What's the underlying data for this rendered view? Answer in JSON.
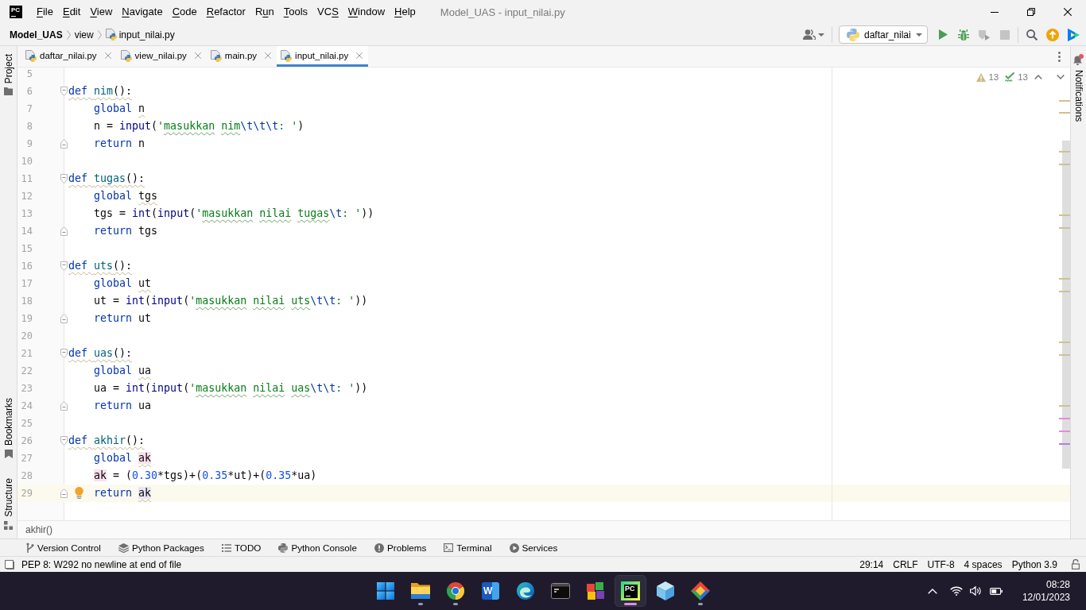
{
  "title_bar": {
    "logo": "PC",
    "menu": [
      {
        "key": "F",
        "rest": "ile"
      },
      {
        "key": "E",
        "rest": "dit"
      },
      {
        "key": "V",
        "rest": "iew"
      },
      {
        "key": "N",
        "rest": "avigate"
      },
      {
        "key": "C",
        "rest": "ode"
      },
      {
        "key": "R",
        "rest": "efactor"
      },
      {
        "lead": "R",
        "key": "u",
        "rest": "n"
      },
      {
        "key": "T",
        "rest": "ools"
      },
      {
        "lead": "VC",
        "key": "S"
      },
      {
        "key": "W",
        "rest": "indow"
      },
      {
        "key": "H",
        "rest": "elp"
      }
    ],
    "title": "Model_UAS - input_nilai.py"
  },
  "navigation_bar": {
    "breadcrumbs": [
      {
        "label": "Model_UAS",
        "kind": "project"
      },
      {
        "label": "view",
        "kind": "folder"
      },
      {
        "label": "input_nilai.py",
        "kind": "file"
      }
    ],
    "run_configuration": "daftar_nilai",
    "actions": [
      {
        "kind": "run",
        "disabled": false
      },
      {
        "kind": "debug",
        "disabled": false
      },
      {
        "kind": "coverage",
        "disabled": true
      },
      {
        "kind": "stop",
        "disabled": true
      }
    ]
  },
  "left_strip": [
    {
      "label": "Project",
      "kind": "project",
      "selected": false
    },
    {
      "label": "Bookmarks",
      "kind": "bookmarks",
      "selected": false
    },
    {
      "label": "Structure",
      "kind": "structure",
      "selected": false
    }
  ],
  "right_strip": {
    "label": "Notifications",
    "unread": true,
    "selected": false
  },
  "tabs": [
    {
      "label": "daftar_nilai.py",
      "selected": false
    },
    {
      "label": "view_nilai.py",
      "selected": false
    },
    {
      "label": "main.py",
      "selected": false
    },
    {
      "label": "input_nilai.py",
      "selected": true
    }
  ],
  "editor": {
    "inspections": [
      {
        "kind": "warning",
        "count": "13"
      },
      {
        "kind": "typo",
        "count": "13"
      }
    ],
    "lines": [
      {
        "number": "5",
        "current": false,
        "bulb": false
      },
      {
        "number": "6",
        "current": false,
        "bulb": false,
        "expanded": true,
        "tokens": [
          {
            "text": "def ",
            "kind": "keyword",
            "warning": true
          },
          {
            "text": "nim",
            "kind": "function",
            "warning": true
          },
          {
            "text": "():",
            "kind": "plain",
            "warning": true
          }
        ],
        "children": [
          {
            "number": "7",
            "current": false,
            "bulb": false,
            "tokens": [
              {
                "text": "global ",
                "kind": "keyword"
              },
              {
                "text": "n",
                "kind": "plain",
                "warning": true
              }
            ]
          },
          {
            "number": "8",
            "current": false,
            "bulb": false,
            "tokens": [
              {
                "text": "n = ",
                "kind": "plain"
              },
              {
                "text": "input",
                "kind": "builtin"
              },
              {
                "text": "(",
                "kind": "plain"
              },
              {
                "text": "'",
                "kind": "string"
              },
              {
                "text": "masukkan nim",
                "kind": "string",
                "typo": true
              },
              {
                "text": "\\t\\t\\t",
                "kind": "escape"
              },
              {
                "text": ": '",
                "kind": "string"
              },
              {
                "text": ")",
                "kind": "plain"
              }
            ]
          },
          {
            "number": "9",
            "current": false,
            "bulb": false,
            "tokens": [
              {
                "text": "return ",
                "kind": "keyword"
              },
              {
                "text": "n",
                "kind": "plain"
              }
            ]
          }
        ]
      },
      {
        "number": "10",
        "current": false,
        "bulb": false
      },
      {
        "number": "11",
        "current": false,
        "bulb": false,
        "expanded": true,
        "tokens": [
          {
            "text": "def ",
            "kind": "keyword",
            "warning": true
          },
          {
            "text": "tugas",
            "kind": "function",
            "warning": true
          },
          {
            "text": "():",
            "kind": "plain",
            "warning": true
          }
        ],
        "children": [
          {
            "number": "12",
            "current": false,
            "bulb": false,
            "tokens": [
              {
                "text": "global ",
                "kind": "keyword"
              },
              {
                "text": "tgs",
                "kind": "plain",
                "warning": true
              }
            ]
          },
          {
            "number": "13",
            "current": false,
            "bulb": false,
            "tokens": [
              {
                "text": "tgs = ",
                "kind": "plain"
              },
              {
                "text": "int",
                "kind": "builtin"
              },
              {
                "text": "(",
                "kind": "plain"
              },
              {
                "text": "input",
                "kind": "builtin"
              },
              {
                "text": "(",
                "kind": "plain"
              },
              {
                "text": "'",
                "kind": "string"
              },
              {
                "text": "masukkan nilai tugas",
                "kind": "string",
                "typo": true
              },
              {
                "text": "\\t",
                "kind": "escape"
              },
              {
                "text": ": '",
                "kind": "string"
              },
              {
                "text": "))",
                "kind": "plain"
              }
            ]
          },
          {
            "number": "14",
            "current": false,
            "bulb": false,
            "tokens": [
              {
                "text": "return ",
                "kind": "keyword"
              },
              {
                "text": "tgs",
                "kind": "plain"
              }
            ]
          }
        ]
      },
      {
        "number": "15",
        "current": false,
        "bulb": false
      },
      {
        "number": "16",
        "current": false,
        "bulb": false,
        "expanded": true,
        "tokens": [
          {
            "text": "def ",
            "kind": "keyword",
            "warning": true
          },
          {
            "text": "uts",
            "kind": "function",
            "warning": true
          },
          {
            "text": "():",
            "kind": "plain",
            "warning": true
          }
        ],
        "children": [
          {
            "number": "17",
            "current": false,
            "bulb": false,
            "tokens": [
              {
                "text": "global ",
                "kind": "keyword"
              },
              {
                "text": "ut",
                "kind": "plain",
                "warning": true
              }
            ]
          },
          {
            "number": "18",
            "current": false,
            "bulb": false,
            "tokens": [
              {
                "text": "ut = ",
                "kind": "plain"
              },
              {
                "text": "int",
                "kind": "builtin"
              },
              {
                "text": "(",
                "kind": "plain"
              },
              {
                "text": "input",
                "kind": "builtin"
              },
              {
                "text": "(",
                "kind": "plain"
              },
              {
                "text": "'",
                "kind": "string"
              },
              {
                "text": "masukkan nilai uts",
                "kind": "string",
                "typo": true
              },
              {
                "text": "\\t\\t",
                "kind": "escape"
              },
              {
                "text": ": '",
                "kind": "string"
              },
              {
                "text": "))",
                "kind": "plain"
              }
            ]
          },
          {
            "number": "19",
            "current": false,
            "bulb": false,
            "tokens": [
              {
                "text": "return ",
                "kind": "keyword"
              },
              {
                "text": "ut",
                "kind": "plain"
              }
            ]
          }
        ]
      },
      {
        "number": "20",
        "current": false,
        "bulb": false
      },
      {
        "number": "21",
        "current": false,
        "bulb": false,
        "expanded": true,
        "tokens": [
          {
            "text": "def ",
            "kind": "keyword",
            "warning": true
          },
          {
            "text": "uas",
            "kind": "function",
            "warning": true
          },
          {
            "text": "():",
            "kind": "plain",
            "warning": true
          }
        ],
        "children": [
          {
            "number": "22",
            "current": false,
            "bulb": false,
            "tokens": [
              {
                "text": "global ",
                "kind": "keyword"
              },
              {
                "text": "ua",
                "kind": "plain",
                "warning": true
              }
            ]
          },
          {
            "number": "23",
            "current": false,
            "bulb": false,
            "tokens": [
              {
                "text": "ua = ",
                "kind": "plain"
              },
              {
                "text": "int",
                "kind": "builtin"
              },
              {
                "text": "(",
                "kind": "plain"
              },
              {
                "text": "input",
                "kind": "builtin"
              },
              {
                "text": "(",
                "kind": "plain"
              },
              {
                "text": "'",
                "kind": "string"
              },
              {
                "text": "masukkan nilai uas",
                "kind": "string",
                "typo": true
              },
              {
                "text": "\\t\\t",
                "kind": "escape"
              },
              {
                "text": ": '",
                "kind": "string"
              },
              {
                "text": "))",
                "kind": "plain"
              }
            ]
          },
          {
            "number": "24",
            "current": false,
            "bulb": false,
            "tokens": [
              {
                "text": "return ",
                "kind": "keyword"
              },
              {
                "text": "ua",
                "kind": "plain"
              }
            ]
          }
        ]
      },
      {
        "number": "25",
        "current": false,
        "bulb": false
      },
      {
        "number": "26",
        "current": false,
        "bulb": false,
        "expanded": true,
        "tokens": [
          {
            "text": "def ",
            "kind": "keyword",
            "warning": true
          },
          {
            "text": "akhir",
            "kind": "function",
            "warning": true
          },
          {
            "text": "():",
            "kind": "plain",
            "warning": true
          }
        ],
        "children": [
          {
            "number": "27",
            "current": false,
            "bulb": false,
            "tokens": [
              {
                "text": "global ",
                "kind": "keyword"
              },
              {
                "text": "ak",
                "kind": "plain",
                "warning": true,
                "highlight_write": true
              }
            ]
          },
          {
            "number": "28",
            "current": false,
            "bulb": false,
            "tokens": [
              {
                "text": "ak",
                "kind": "plain",
                "highlight_write": true
              },
              {
                "text": " = (",
                "kind": "plain"
              },
              {
                "text": "0.30",
                "kind": "number"
              },
              {
                "text": "*tgs)+(",
                "kind": "plain"
              },
              {
                "text": "0.35",
                "kind": "number"
              },
              {
                "text": "*ut)+(",
                "kind": "plain"
              },
              {
                "text": "0.35",
                "kind": "number"
              },
              {
                "text": "*ua)",
                "kind": "plain"
              }
            ]
          },
          {
            "number": "29",
            "current": true,
            "bulb": true,
            "tokens": [
              {
                "text": "return ",
                "kind": "keyword"
              },
              {
                "text": "ak",
                "kind": "plain",
                "warning": true,
                "highlight_read": true
              }
            ]
          }
        ]
      }
    ],
    "error_stripe": [
      {
        "kind": "warning"
      },
      {
        "kind": "warning"
      },
      {
        "kind": "warning"
      },
      {
        "kind": "warning"
      },
      {
        "kind": "warning"
      },
      {
        "kind": "warning"
      },
      {
        "kind": "warning"
      },
      {
        "kind": "warning"
      },
      {
        "kind": "warning"
      },
      {
        "kind": "warning"
      },
      {
        "kind": "warning"
      },
      {
        "kind": "write"
      },
      {
        "kind": "write"
      },
      {
        "kind": "read"
      }
    ]
  },
  "editor_breadcrumb": "akhir()",
  "tool_windows": [
    {
      "label": "Version Control",
      "kind": "vcs"
    },
    {
      "label": "Python Packages",
      "kind": "packages"
    },
    {
      "label": "TODO",
      "kind": "todo"
    },
    {
      "label": "Python Console",
      "kind": "console"
    },
    {
      "label": "Problems",
      "kind": "problems"
    },
    {
      "label": "Terminal",
      "kind": "terminal"
    },
    {
      "label": "Services",
      "kind": "services"
    }
  ],
  "status_bar": {
    "message": "PEP 8: W292 no newline at end of file",
    "widgets": [
      "29:14",
      "CRLF",
      "UTF-8",
      "4 spaces",
      "Python 3.9"
    ]
  },
  "taskbar": {
    "apps": [
      {
        "kind": "start",
        "running": false,
        "active": false
      },
      {
        "kind": "explorer",
        "running": true,
        "active": false
      },
      {
        "kind": "chrome",
        "running": true,
        "active": false
      },
      {
        "kind": "word",
        "label": "W",
        "running": false,
        "active": false
      },
      {
        "kind": "edge",
        "running": false,
        "active": false
      },
      {
        "kind": "terminal",
        "running": false,
        "active": false
      },
      {
        "kind": "blocks",
        "running": false,
        "active": false
      },
      {
        "kind": "pycharm",
        "label": "PC",
        "running": true,
        "active": true
      },
      {
        "kind": "cube",
        "running": false,
        "active": false
      },
      {
        "kind": "diamond",
        "running": true,
        "active": false
      }
    ],
    "time": "08:28",
    "date": "12/01/2023"
  }
}
